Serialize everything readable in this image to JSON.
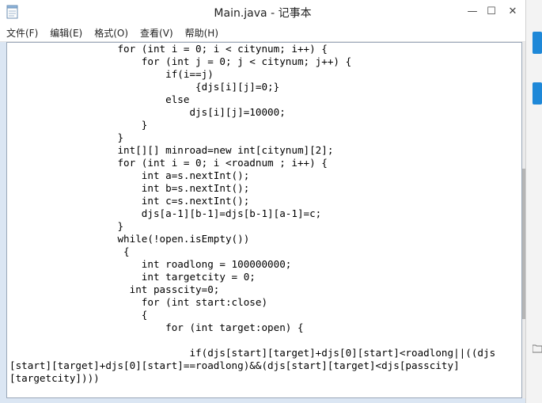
{
  "window": {
    "title": "Main.java - 记事本"
  },
  "controls": {
    "minimize": "—",
    "maximize": "☐",
    "close": "✕"
  },
  "menu": {
    "file": "文件(F)",
    "edit": "编辑(E)",
    "format": "格式(O)",
    "view": "查看(V)",
    "help": "帮助(H)"
  },
  "editor": {
    "lines": [
      "                  for (int i = 0; i < citynum; i++) {",
      "                      for (int j = 0; j < citynum; j++) {",
      "                          if(i==j)",
      "                               {djs[i][j]=0;}",
      "                          else",
      "                              djs[i][j]=10000;",
      "                      }",
      "                  }",
      "                  int[][] minroad=new int[citynum][2];",
      "                  for (int i = 0; i <roadnum ; i++) {",
      "                      int a=s.nextInt();",
      "                      int b=s.nextInt();",
      "                      int c=s.nextInt();",
      "                      djs[a-1][b-1]=djs[b-1][a-1]=c;",
      "                  }",
      "                  while(!open.isEmpty())",
      "                   {",
      "                      int roadlong = 100000000;",
      "                      int targetcity = 0;",
      "                    int passcity=0;",
      "                      for (int start:close)",
      "                      {",
      "                          for (int target:open) {",
      "",
      "                              if(djs[start][target]+djs[0][start]<roadlong||((djs",
      "[start][target]+djs[0][start]==roadlong)&&(djs[start][target]<djs[passcity]",
      "[targetcity])))"
    ]
  }
}
